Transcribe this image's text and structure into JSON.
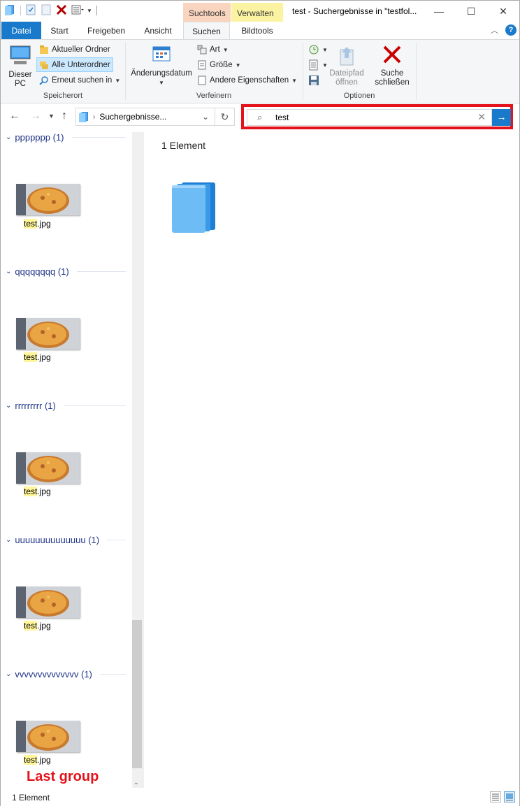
{
  "window": {
    "title": "test - Suchergebnisse in \"testfol...",
    "context_tabs": {
      "suchtools": "Suchtools",
      "verwalten": "Verwalten"
    },
    "controls": {
      "minimize": "—",
      "maximize": "☐",
      "close": "✕"
    }
  },
  "ribbon_tabs": [
    {
      "label": "Datei"
    },
    {
      "label": "Start"
    },
    {
      "label": "Freigeben"
    },
    {
      "label": "Ansicht"
    },
    {
      "label": "Suchen"
    },
    {
      "label": "Bildtools"
    }
  ],
  "ribbon": {
    "speicherort": {
      "label": "Speicherort",
      "dieser_pc": "Dieser PC",
      "aktueller_ordner": "Aktueller Ordner",
      "alle_unterordner": "Alle Unterordner",
      "erneut_suchen": "Erneut suchen in"
    },
    "verfeinern": {
      "label": "Verfeinern",
      "aenderungsdatum": "Änderungsdatum",
      "art": "Art",
      "groesse": "Größe",
      "andere": "Andere Eigenschaften"
    },
    "optionen": {
      "label": "Optionen",
      "dateipfad": "Dateipfad öffnen",
      "suche_schliessen": "Suche schließen"
    }
  },
  "address": {
    "path": "Suchergebnisse..."
  },
  "search": {
    "value": "test",
    "accent": "#e4121b"
  },
  "groups": [
    {
      "name": "ppppppp (1)",
      "file_hl": "test",
      "file_ext": ".jpg"
    },
    {
      "name": "qqqqqqqq (1)",
      "file_hl": "test",
      "file_ext": ".jpg"
    },
    {
      "name": "rrrrrrrrr (1)",
      "file_hl": "test",
      "file_ext": ".jpg"
    },
    {
      "name": "uuuuuuuuuuuuuu (1)",
      "file_hl": "test",
      "file_ext": ".jpg"
    },
    {
      "name": "vvvvvvvvvvvvvv (1)",
      "file_hl": "test",
      "file_ext": ".jpg"
    }
  ],
  "annotation": "Last group",
  "main": {
    "count": "1 Element"
  },
  "status": {
    "count": "1 Element"
  }
}
